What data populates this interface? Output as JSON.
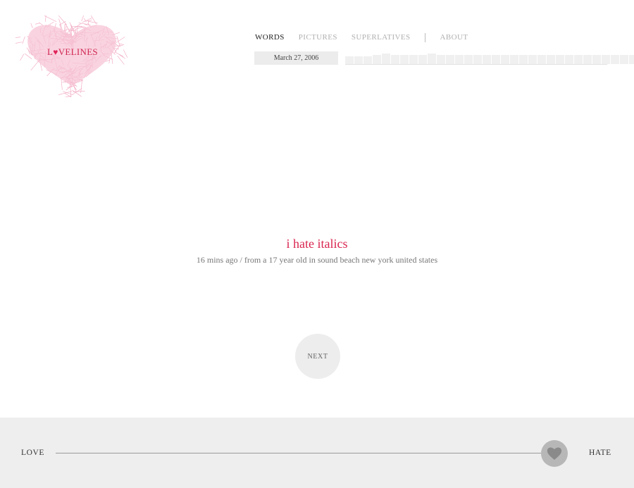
{
  "logo": {
    "text_before": "L",
    "text_after": "VELINES",
    "icon": "heart-icon",
    "color": "#e0245a"
  },
  "nav": {
    "items": [
      {
        "label": "WORDS",
        "active": true
      },
      {
        "label": "PICTURES",
        "active": false
      },
      {
        "label": "SUPERLATIVES",
        "active": false
      },
      {
        "label": "ABOUT",
        "active": false
      }
    ]
  },
  "timeline": {
    "date": "March 27, 2006",
    "days": [
      0.5,
      0.5,
      0.5,
      0.6,
      0.7,
      0.6,
      0.6,
      0.6,
      0.6,
      0.7,
      0.6,
      0.6,
      0.6,
      0.6,
      0.6,
      0.6,
      0.6,
      0.6,
      0.6,
      0.6,
      0.6,
      0.6,
      0.6,
      0.6,
      0.6,
      0.6,
      0.6,
      0.6,
      0.6,
      0.6,
      0.6,
      0.6,
      0.6,
      0.4
    ],
    "selected_index": 33
  },
  "message": {
    "text": "i hate italics",
    "meta": "16 mins ago / from a 17 year old in sound beach new york united states",
    "color": "#d9254f"
  },
  "next": {
    "label": "NEXT"
  },
  "footer": {
    "love_label": "LOVE",
    "hate_label": "HATE",
    "slider_value": 1.0
  }
}
